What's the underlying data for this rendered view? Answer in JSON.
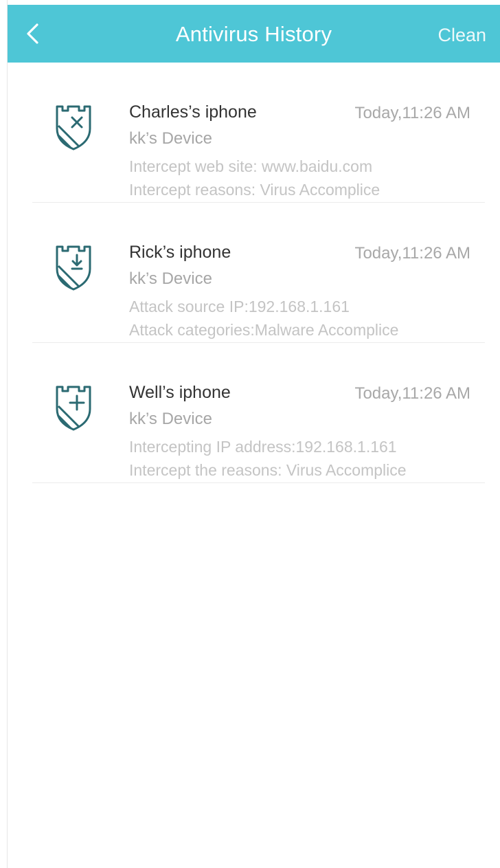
{
  "header": {
    "title": "Antivirus History",
    "clean_label": "Clean",
    "back_icon": "chevron-left-icon",
    "background_color": "#4ec6d6"
  },
  "records": [
    {
      "icon": "shield-x-icon",
      "name": "Charles’s iphone",
      "time": "Today,11:26 AM",
      "device": "kk’s Device",
      "detail1": "Intercept web site: www.baidu.com",
      "detail2": "Intercept reasons: Virus Accomplice"
    },
    {
      "icon": "shield-download-icon",
      "name": "Rick’s iphone",
      "time": "Today,11:26 AM",
      "device": "kk’s Device",
      "detail1": "Attack source IP:192.168.1.161",
      "detail2": "Attack categories:Malware Accomplice"
    },
    {
      "icon": "shield-plus-icon",
      "name": "Well’s iphone",
      "time": "Today,11:26 AM",
      "device": "kk’s Device",
      "detail1": "Intercepting IP address:192.168.1.161",
      "detail2": "Intercept the reasons: Virus Accomplice"
    }
  ],
  "colors": {
    "icon_stroke": "#2b6a72",
    "accent": "#4ec6d6"
  }
}
